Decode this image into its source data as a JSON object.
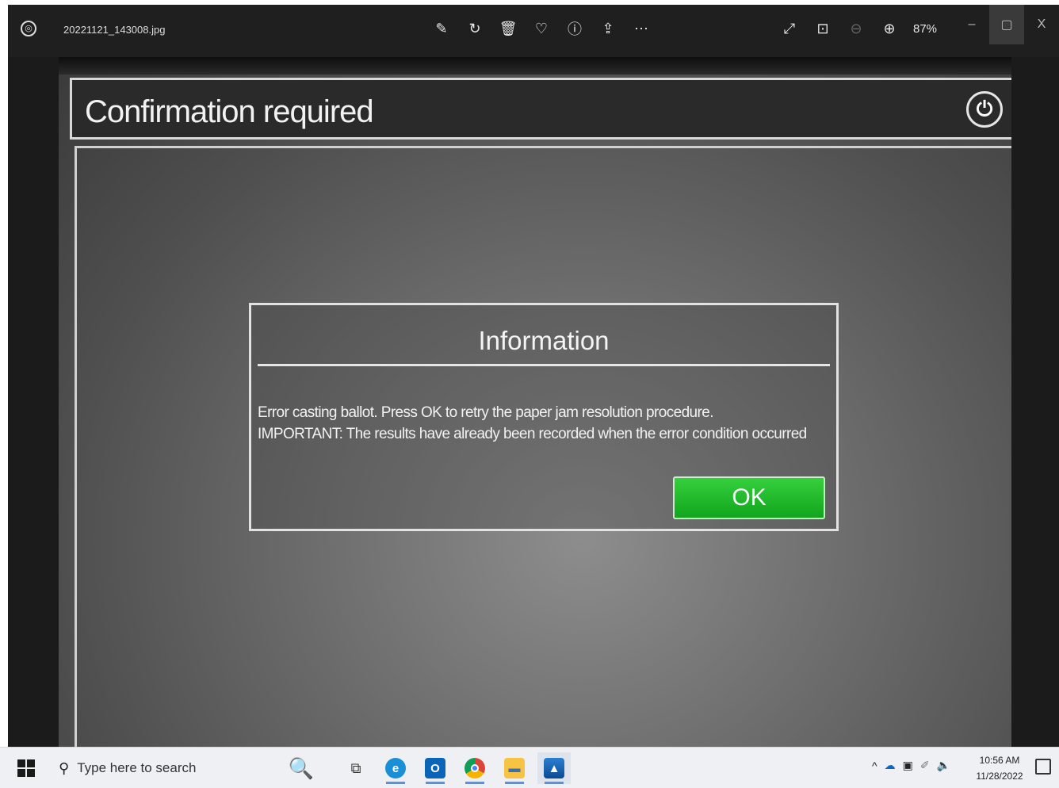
{
  "photos_app": {
    "file_name": "20221121_143008.jpg",
    "zoom_level": "87%",
    "toolbar_icons": [
      "edit-image-icon",
      "rotate-icon",
      "delete-icon",
      "favorite-icon",
      "info-icon",
      "share-icon",
      "more-icon"
    ],
    "view_icons": [
      "fullscreen-icon",
      "actual-size-icon",
      "zoom-out-icon",
      "zoom-in-icon"
    ],
    "window_controls": {
      "minimize": "–",
      "maximize": "▢",
      "close": "X"
    }
  },
  "screen": {
    "title": "Confirmation required",
    "dialog": {
      "title": "Information",
      "message_line1": "Error casting ballot. Press OK to retry the paper jam resolution procedure.",
      "message_line2": "IMPORTANT: The results have already been recorded when the error condition occurred",
      "ok_label": "OK"
    }
  },
  "taskbar": {
    "search_placeholder": "Type here to search",
    "pinned_apps": [
      "task-view-icon",
      "edge-icon",
      "outlook-icon",
      "chrome-icon",
      "file-explorer-icon",
      "photos-icon"
    ],
    "tray_icons": [
      "chevron-up-icon",
      "onedrive-icon",
      "network-icon",
      "pen-icon",
      "volume-icon"
    ],
    "time": "10:56 AM",
    "date": "11/28/2022"
  }
}
